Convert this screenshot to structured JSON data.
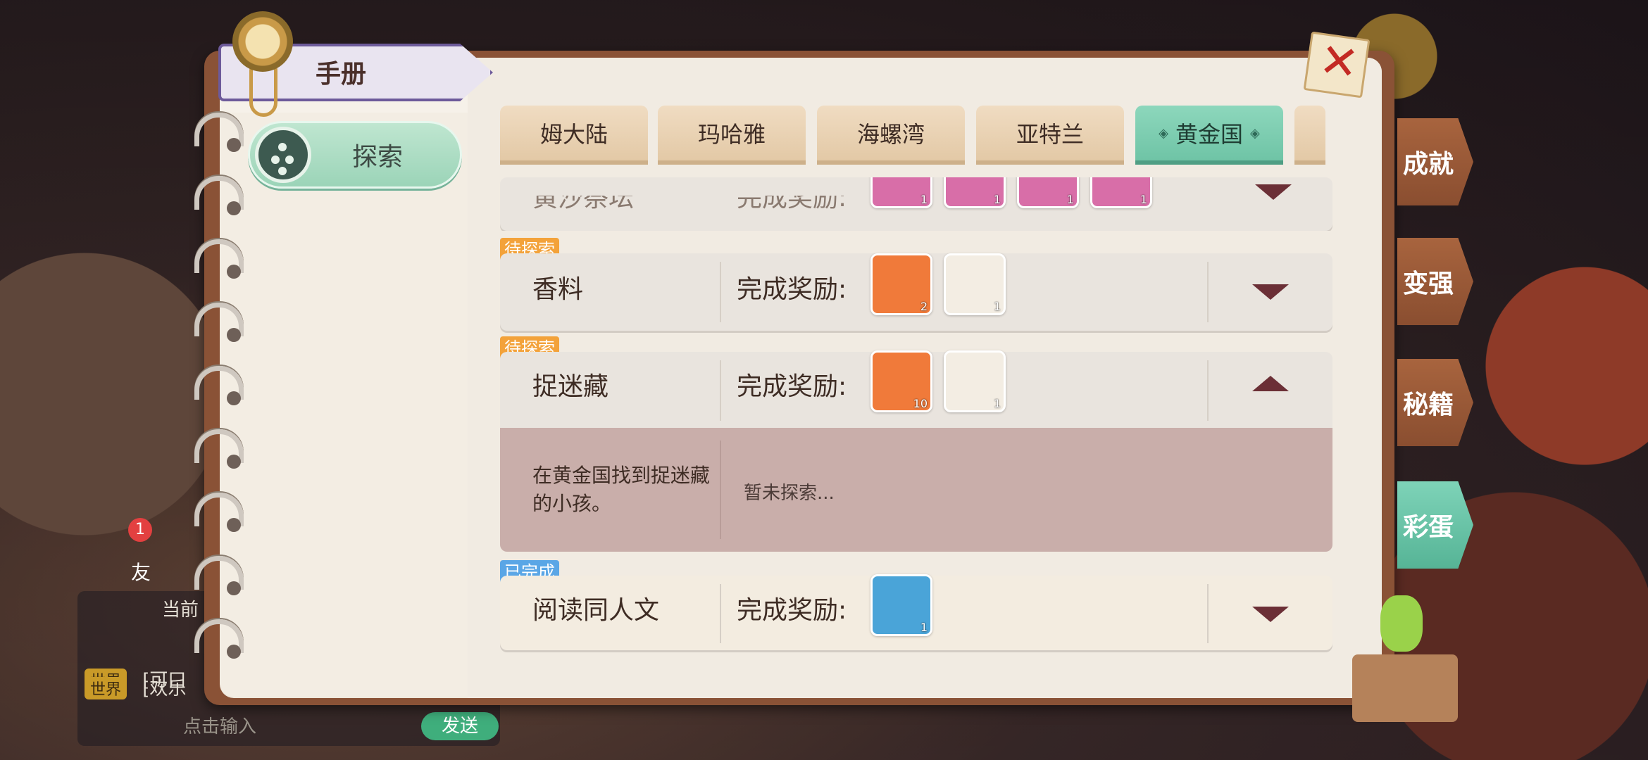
{
  "header": {
    "title": "手册"
  },
  "left_nav": {
    "explore_label": "探索"
  },
  "region_tabs": [
    {
      "label": "姆大陆",
      "active": false
    },
    {
      "label": "玛哈雅",
      "active": false
    },
    {
      "label": "海螺湾",
      "active": false
    },
    {
      "label": "亚特兰",
      "active": false
    },
    {
      "label": "黄金国",
      "active": true
    }
  ],
  "side_tabs": [
    {
      "label": "成就",
      "active": false
    },
    {
      "label": "变强",
      "active": false
    },
    {
      "label": "秘籍",
      "active": false
    },
    {
      "label": "彩蛋",
      "active": true
    }
  ],
  "entries": [
    {
      "status": "",
      "title": "黄沙祭坛",
      "reward_label": "完成奖励:",
      "rewards": [
        {
          "icon": "seed-bag-icon",
          "qty": "1"
        },
        {
          "icon": "pet-orange-icon",
          "qty": "1"
        },
        {
          "icon": "pet-blue-icon",
          "qty": "1"
        },
        {
          "icon": "pet-green-icon",
          "qty": "1"
        }
      ],
      "expanded": false
    },
    {
      "status": "待探索",
      "title": "香料",
      "reward_label": "完成奖励:",
      "rewards": [
        {
          "icon": "crystal-icon",
          "qty": "2"
        },
        {
          "icon": "blue-lobster-icon",
          "qty": "1"
        }
      ],
      "expanded": false
    },
    {
      "status": "待探索",
      "title": "捉迷藏",
      "reward_label": "完成奖励:",
      "rewards": [
        {
          "icon": "green-orb-icon",
          "qty": "10"
        },
        {
          "icon": "pink-gift-bag-icon",
          "qty": "1"
        }
      ],
      "expanded": true,
      "description": "在黄金国找到捉迷藏的小孩。",
      "progress": "暂未探索..."
    },
    {
      "status": "已完成",
      "title": "阅读同人文",
      "reward_label": "完成奖励:",
      "rewards": [
        {
          "icon": "silver-coin-icon",
          "qty": "1"
        }
      ],
      "expanded": false
    }
  ],
  "chat": {
    "lines": [
      {
        "channel": "世界",
        "text": "[可口"
      },
      {
        "channel": "世界",
        "text": "[欢乐"
      }
    ],
    "partial_label": "当前",
    "input_placeholder": "点击输入",
    "send_label": "发送",
    "friends_label": "友",
    "friends_badge": "1"
  },
  "colors": {
    "active_tab": "#6fc4a6",
    "pending_badge": "#f3a23a",
    "done_badge": "#5aa6e6",
    "arrow": "#6b2f36"
  }
}
